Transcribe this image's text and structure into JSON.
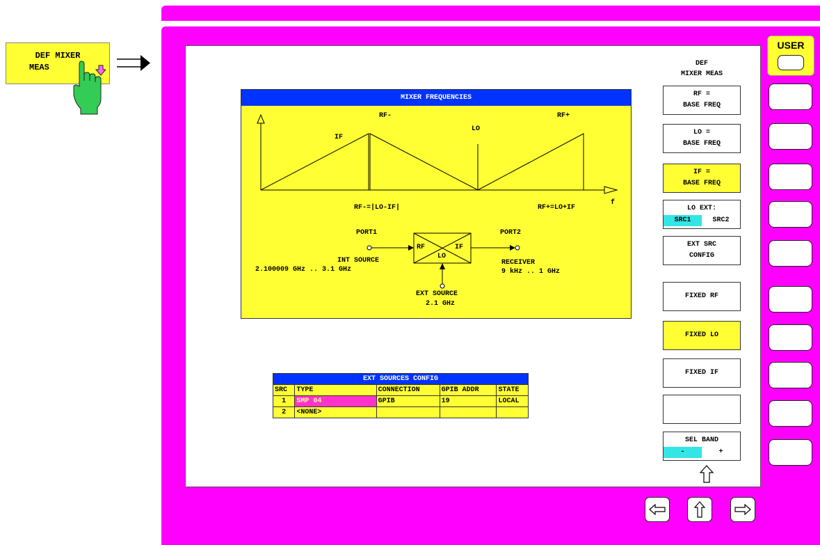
{
  "hardkey": {
    "label_line1": "DEF MIXER",
    "label_line2": "MEAS"
  },
  "user_key": {
    "label": "USER"
  },
  "softkey_menu": {
    "title_line1": "DEF",
    "title_line2": "MIXER MEAS",
    "rf_base": {
      "line1": "RF =",
      "line2": "BASE FREQ"
    },
    "lo_base": {
      "line1": "LO =",
      "line2": "BASE FREQ"
    },
    "if_base": {
      "line1": "IF =",
      "line2": "BASE FREQ"
    },
    "lo_ext": {
      "label": "LO EXT:",
      "opt1": "SRC1",
      "opt2": "SRC2"
    },
    "ext_src": {
      "line1": "EXT SRC",
      "line2": "CONFIG"
    },
    "fixed_rf": "FIXED RF",
    "fixed_lo": "FIXED LO",
    "fixed_if": "FIXED IF",
    "sel_band": {
      "label": "SEL BAND",
      "minus": "-",
      "plus": "+"
    }
  },
  "mixer_panel": {
    "title": "MIXER FREQUENCIES",
    "rf_minus": "RF-",
    "rf_plus": "RF+",
    "lo": "LO",
    "if": "IF",
    "f": "f",
    "rf_minus_formula": "RF-=|LO-IF|",
    "rf_plus_formula": "RF+=LO+IF",
    "port1": "PORT1",
    "port2": "PORT2",
    "mixer_rf": "RF",
    "mixer_if": "IF",
    "mixer_lo": "LO",
    "int_source": "INT SOURCE",
    "int_source_range": "2.100009 GHz .. 3.1 GHz",
    "receiver": "RECEIVER",
    "receiver_range": "9 kHz .. 1 GHz",
    "ext_source": "EXT SOURCE",
    "ext_source_freq": "2.1 GHz"
  },
  "ext_sources_table": {
    "title": "EXT SOURCES CONFIG",
    "headers": [
      "SRC",
      "TYPE",
      "CONNECTION",
      "GPIB ADDR",
      "STATE"
    ],
    "rows": [
      [
        "1",
        "SMP 04",
        "GPIB",
        "19",
        "LOCAL"
      ],
      [
        "2",
        "<NONE>",
        "",
        "",
        ""
      ]
    ]
  },
  "colors": {
    "frame": "#ff00ff",
    "panel": "#ffff33",
    "header": "#0033ff",
    "selected": "#33e5e5",
    "hand": "#33cc55"
  }
}
